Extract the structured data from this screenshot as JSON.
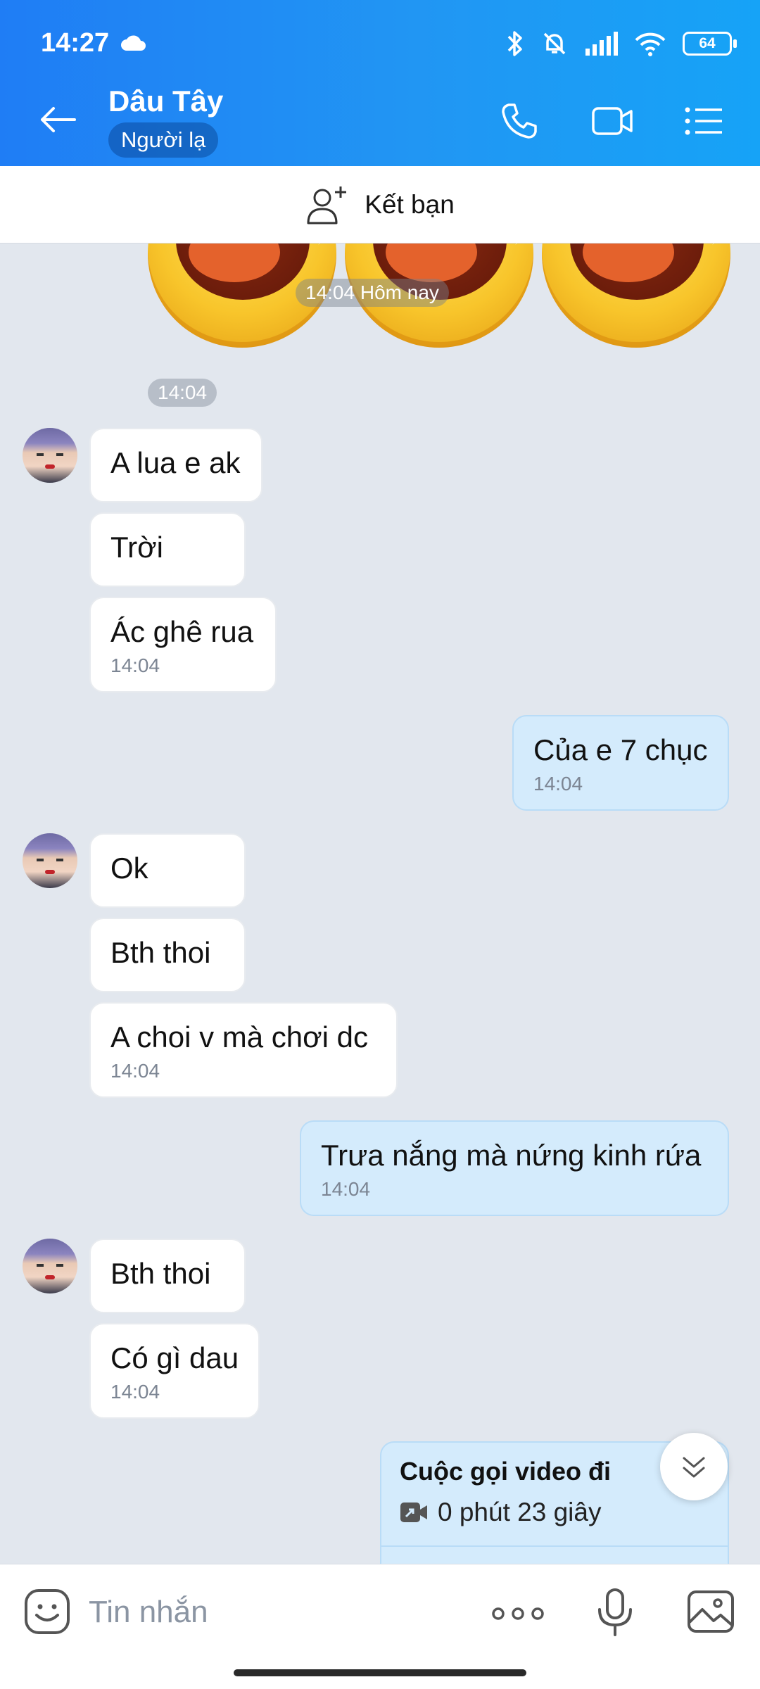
{
  "status_bar": {
    "time": "14:27",
    "battery": "64"
  },
  "header": {
    "title": "Dâu Tây",
    "badge": "Người lạ"
  },
  "add_friend": {
    "label": "Kết bạn"
  },
  "messages": {
    "sticker_time": "14:04 Hôm nay",
    "group1_time": "14:04",
    "m1": "A lua e ak",
    "m2": "Trời",
    "m3": "Ác ghê rua",
    "m3_time": "14:04",
    "m4": "Của e 7 chục",
    "m4_time": "14:04",
    "m5": "Ok",
    "m6": "Bth thoi",
    "m7": "A choi v mà chơi dc",
    "m7_time": "14:04",
    "m8": "Trưa nắng mà nứng kinh rứa",
    "m8_time": "14:04",
    "m9": "Bth thoi",
    "m10": "Có gì dau",
    "m10_time": "14:04",
    "call_title": "Cuộc gọi video đi",
    "call_duration": "0 phút 23 giây"
  },
  "input": {
    "placeholder": "Tin nhắn"
  },
  "colors": {
    "header_start": "#1f7df5",
    "header_end": "#16a3f7",
    "my_bubble": "#d4ebfc",
    "chat_bg": "#e2e7ee"
  },
  "icons": [
    "back-arrow-icon",
    "phone-icon",
    "video-camera-icon",
    "list-menu-icon",
    "add-person-icon",
    "sticker-icon",
    "more-dots-icon",
    "microphone-icon",
    "image-icon",
    "chevron-double-down-icon"
  ]
}
